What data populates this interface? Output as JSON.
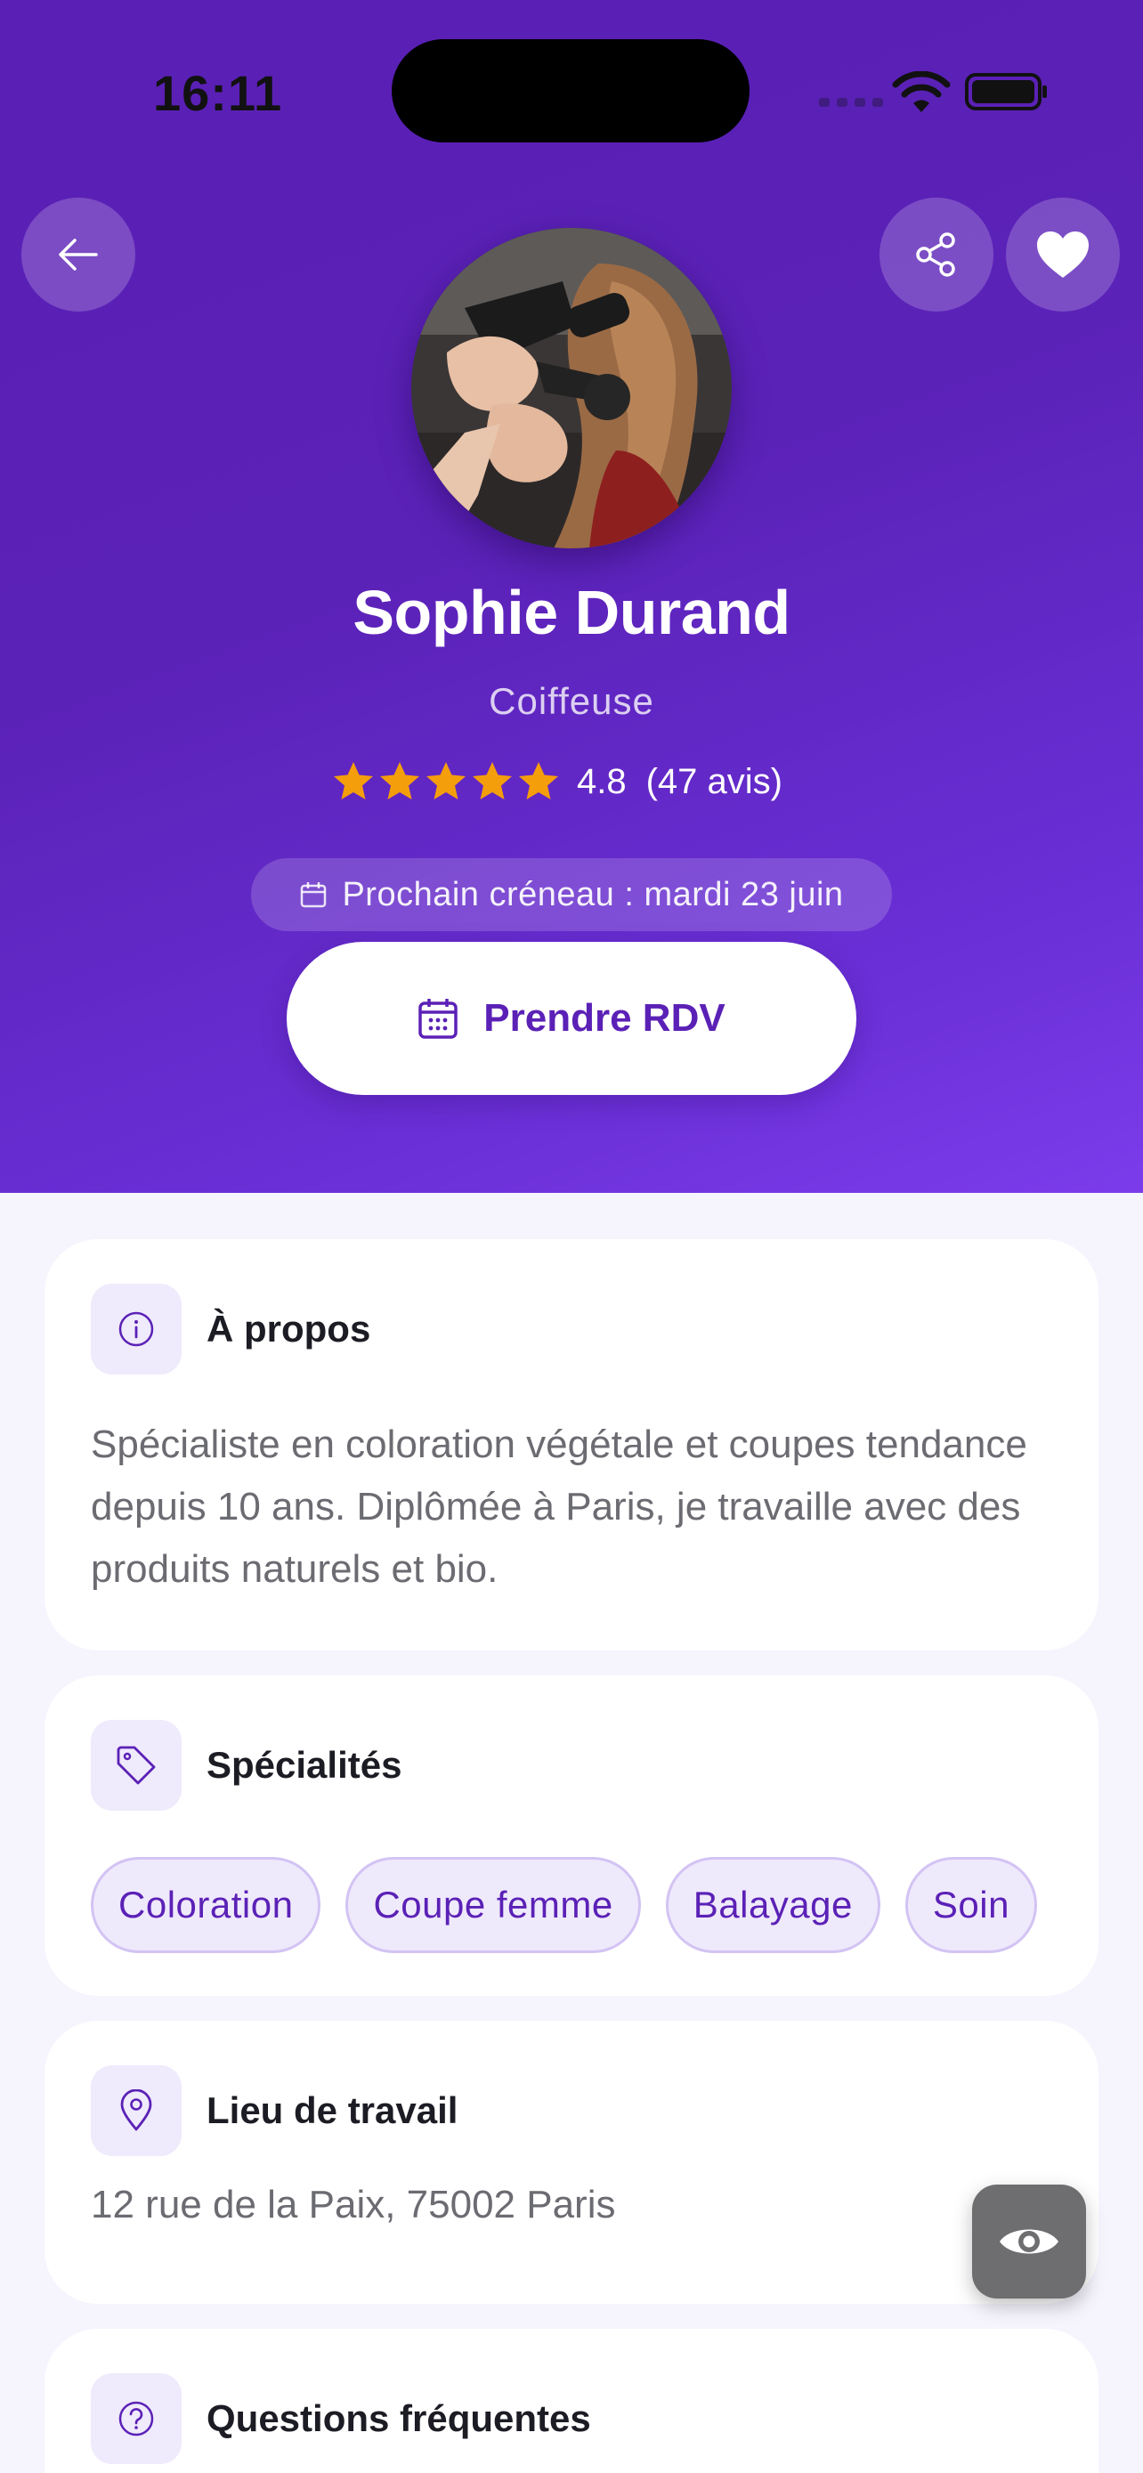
{
  "status_bar": {
    "time": "16:11"
  },
  "profile": {
    "name": "Sophie Durand",
    "job": "Coiffeuse",
    "rating_value": "4.8",
    "rating_count": "(47 avis)",
    "stars": 5,
    "next_slot": "Prochain créneau : mardi 23 juin",
    "cta_label": "Prendre RDV"
  },
  "about": {
    "title": "À propos",
    "text": "Spécialiste en coloration végétale et coupes tendance depuis 10 ans. Diplômée à Paris, je travaille avec des produits naturels et bio."
  },
  "specialties": {
    "title": "Spécialités",
    "tags": [
      "Coloration",
      "Coupe femme",
      "Balayage",
      "Soin"
    ]
  },
  "workplace": {
    "title": "Lieu de travail",
    "address": "12 rue de la Paix, 75002 Paris"
  },
  "faq": {
    "title": "Questions fréquentes"
  },
  "colors": {
    "primary": "#5b21b6",
    "hero_start": "#5a1fb4",
    "hero_end": "#7b3ceb",
    "star": "#f59e0b",
    "icon_bg": "#efeafc"
  },
  "icons": [
    "back-arrow-icon",
    "share-icon",
    "heart-icon",
    "calendar-icon",
    "info-icon",
    "tag-icon",
    "location-pin-icon",
    "question-icon",
    "eye-icon"
  ]
}
